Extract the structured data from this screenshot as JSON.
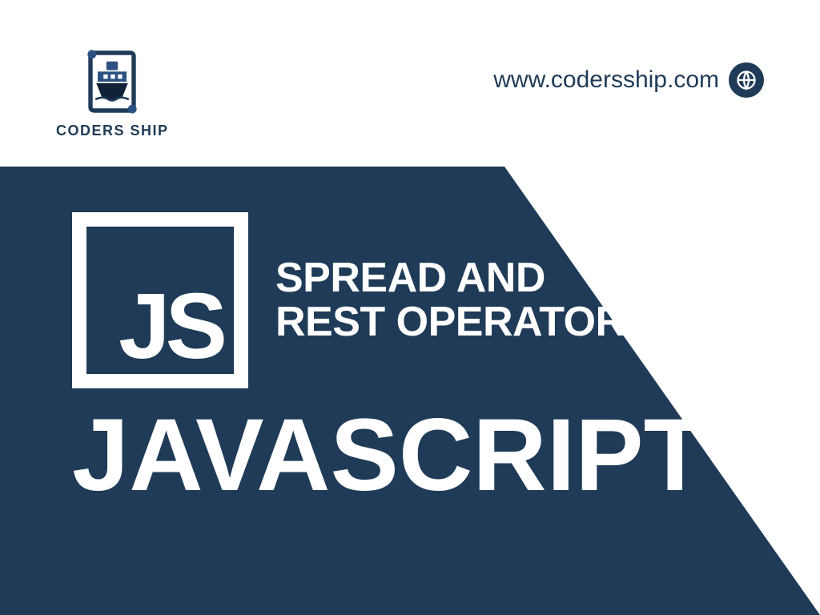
{
  "brand": {
    "name": "CODERS SHIP"
  },
  "url": {
    "text": "www.codersship.com"
  },
  "hero": {
    "js_badge": "JS",
    "topic_line1": "SPREAD AND",
    "topic_line2": "REST OPERATORS",
    "language": "JAVASCRIPT"
  },
  "colors": {
    "primary": "#1f3b57",
    "primary_light": "#2a5181"
  }
}
